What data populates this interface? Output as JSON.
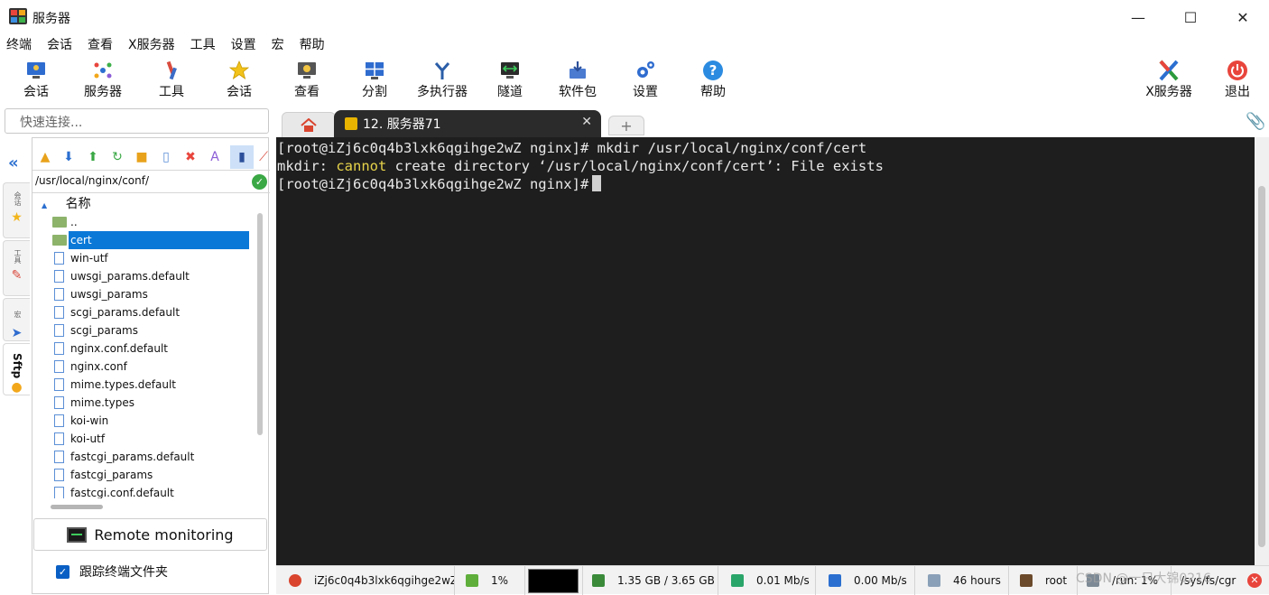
{
  "window": {
    "title": "服务器",
    "controls": {
      "minimize": "—",
      "maximize": "☐",
      "close": "✕"
    }
  },
  "menu": [
    "终端",
    "会话",
    "查看",
    "X服务器",
    "工具",
    "设置",
    "宏",
    "帮助"
  ],
  "toolbar": {
    "session": "会话",
    "servers": "服务器",
    "tools": "工具",
    "sessions": "会话",
    "view": "查看",
    "split": "分割",
    "multiexec": "多执行器",
    "tunnel": "隧道",
    "packages": "软件包",
    "settings": "设置",
    "help": "帮助",
    "xserver": "X服务器",
    "exit": "退出"
  },
  "quick_connect": {
    "placeholder": "快速连接..."
  },
  "tabs": {
    "active": {
      "label": "12. 服务器71",
      "close": "✕"
    },
    "add": "+"
  },
  "side_tabs": {
    "sessions": "会话",
    "tools": "工具",
    "macros": "宏",
    "sftp": "Sftp"
  },
  "sftp": {
    "path": "/usr/local/nginx/conf/",
    "column_name": "名称",
    "files": [
      {
        "name": "..",
        "type": "up"
      },
      {
        "name": "cert",
        "type": "folder",
        "selected": true
      },
      {
        "name": "win-utf",
        "type": "file"
      },
      {
        "name": "uwsgi_params.default",
        "type": "file"
      },
      {
        "name": "uwsgi_params",
        "type": "file"
      },
      {
        "name": "scgi_params.default",
        "type": "file"
      },
      {
        "name": "scgi_params",
        "type": "file"
      },
      {
        "name": "nginx.conf.default",
        "type": "file"
      },
      {
        "name": "nginx.conf",
        "type": "file"
      },
      {
        "name": "mime.types.default",
        "type": "file"
      },
      {
        "name": "mime.types",
        "type": "file"
      },
      {
        "name": "koi-win",
        "type": "file"
      },
      {
        "name": "koi-utf",
        "type": "file"
      },
      {
        "name": "fastcgi_params.default",
        "type": "file"
      },
      {
        "name": "fastcgi_params",
        "type": "file"
      },
      {
        "name": "fastcgi.conf.default",
        "type": "file"
      }
    ],
    "remote_monitoring": "Remote monitoring",
    "follow_terminal_folder": "跟踪终端文件夹"
  },
  "terminal": {
    "line1": "[root@iZj6c0q4b3lxk6qgihge2wZ nginx]# mkdir /usr/local/nginx/conf/cert",
    "line2_prefix": "mkdir: ",
    "line2_hl": "cannot",
    "line2_rest": " create directory ‘/usr/local/nginx/conf/cert’: File exists",
    "line3": "[root@iZj6c0q4b3lxk6qgihge2wZ nginx]#"
  },
  "status": {
    "host": "iZj6c0q4b3lxk6qgihge2wZ",
    "cpu": "1%",
    "memory": "1.35 GB / 3.65 GB",
    "upload": "0.01 Mb/s",
    "download": "0.00 Mb/s",
    "uptime": "46 hours",
    "user": "root",
    "run": "/run: 1%",
    "sys": "/sys/fs/cgr"
  },
  "watermark": "CSDN @一只大锦0216",
  "colors": {
    "terminal_bg": "#1e1e1e",
    "highlight": "#e6d34a",
    "selection": "#0a78d7"
  }
}
